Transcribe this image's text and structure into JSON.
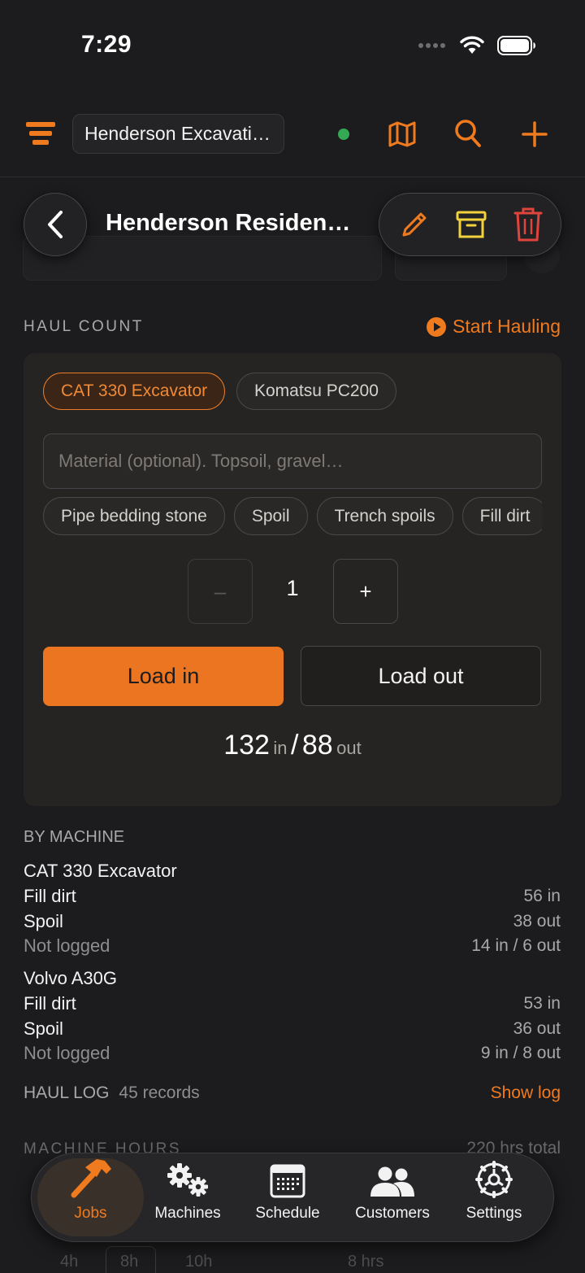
{
  "status_bar": {
    "time": "7:29"
  },
  "top_bar": {
    "company_name": "Henderson Excavati…",
    "online_status_color": "#34a853",
    "icons": [
      "menu-icon",
      "map-icon",
      "search-icon",
      "plus-icon"
    ]
  },
  "header": {
    "title": "Henderson Residen…",
    "actions": [
      "edit-icon",
      "archive-icon",
      "trash-icon"
    ]
  },
  "haul_count": {
    "section_label": "HAUL COUNT",
    "start_label": "Start Hauling",
    "machines": [
      "CAT 330 Excavator",
      "Komatsu PC200"
    ],
    "selected_machine": "CAT 330 Excavator",
    "material_placeholder": "Material (optional). Topsoil, gravel…",
    "material_suggestions": [
      "Pipe bedding stone",
      "Spoil",
      "Trench spoils",
      "Fill dirt"
    ],
    "stepper": {
      "minus": "–",
      "value": "1",
      "plus": "+"
    },
    "load_in_label": "Load in",
    "load_out_label": "Load out",
    "totals": {
      "in_count": "132",
      "in_label": "in",
      "separator": "/",
      "out_count": "88",
      "out_label": "out"
    }
  },
  "by_machine": {
    "section_label": "BY MACHINE",
    "machines": [
      {
        "name": "CAT 330 Excavator",
        "rows": [
          {
            "material": "Fill dirt",
            "value": "56 in"
          },
          {
            "material": "Spoil",
            "value": "38 out"
          },
          {
            "material": "Not logged",
            "value": "14 in / 6 out"
          }
        ]
      },
      {
        "name": "Volvo A30G",
        "rows": [
          {
            "material": "Fill dirt",
            "value": "53 in"
          },
          {
            "material": "Spoil",
            "value": "36 out"
          },
          {
            "material": "Not logged",
            "value": "9 in / 8 out"
          }
        ]
      }
    ]
  },
  "haul_log": {
    "label": "HAUL LOG",
    "count": "45 records",
    "show_label": "Show log"
  },
  "machine_hours": {
    "section_label": "MACHINE HOURS",
    "total": "220 hrs total",
    "presets": [
      "4h",
      "8h",
      "10h"
    ],
    "value": "8 hrs"
  },
  "tab_bar": {
    "tabs": [
      {
        "label": "Jobs",
        "icon": "hammer-icon",
        "active": true
      },
      {
        "label": "Machines",
        "icon": "gears-icon",
        "active": false
      },
      {
        "label": "Schedule",
        "icon": "calendar-icon",
        "active": false
      },
      {
        "label": "Customers",
        "icon": "people-icon",
        "active": false
      },
      {
        "label": "Settings",
        "icon": "gear-icon",
        "active": false
      }
    ]
  },
  "colors": {
    "accent": "#eb7520",
    "archive": "#f2d23c",
    "delete": "#e0443c",
    "background": "#1c1c1e"
  }
}
